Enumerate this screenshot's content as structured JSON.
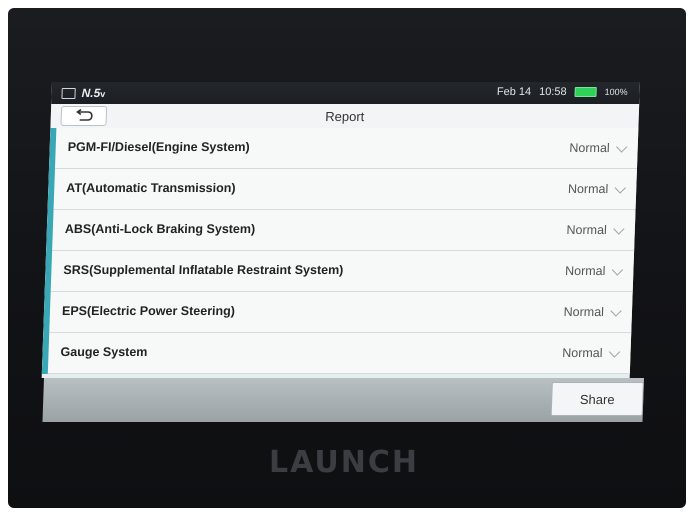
{
  "status_bar": {
    "app_badge": "N.5",
    "app_badge_suffix": "v",
    "date": "Feb 14",
    "time": "10:58",
    "battery": "100%",
    "battery_color": "#2fd158"
  },
  "header": {
    "title": "Report",
    "back_icon": "back-arrow-icon"
  },
  "systems": [
    {
      "label": "PGM-FI/Diesel(Engine System)",
      "status": "Normal"
    },
    {
      "label": "AT(Automatic Transmission)",
      "status": "Normal"
    },
    {
      "label": "ABS(Anti-Lock Braking System)",
      "status": "Normal"
    },
    {
      "label": "SRS(Supplemental Inflatable Restraint System)",
      "status": "Normal"
    },
    {
      "label": "EPS(Electric Power Steering)",
      "status": "Normal"
    },
    {
      "label": "Gauge System",
      "status": "Normal"
    }
  ],
  "footer": {
    "share_label": "Share"
  },
  "device": {
    "brand": "LAUNCH",
    "accent_color": "#3aa7b7"
  }
}
